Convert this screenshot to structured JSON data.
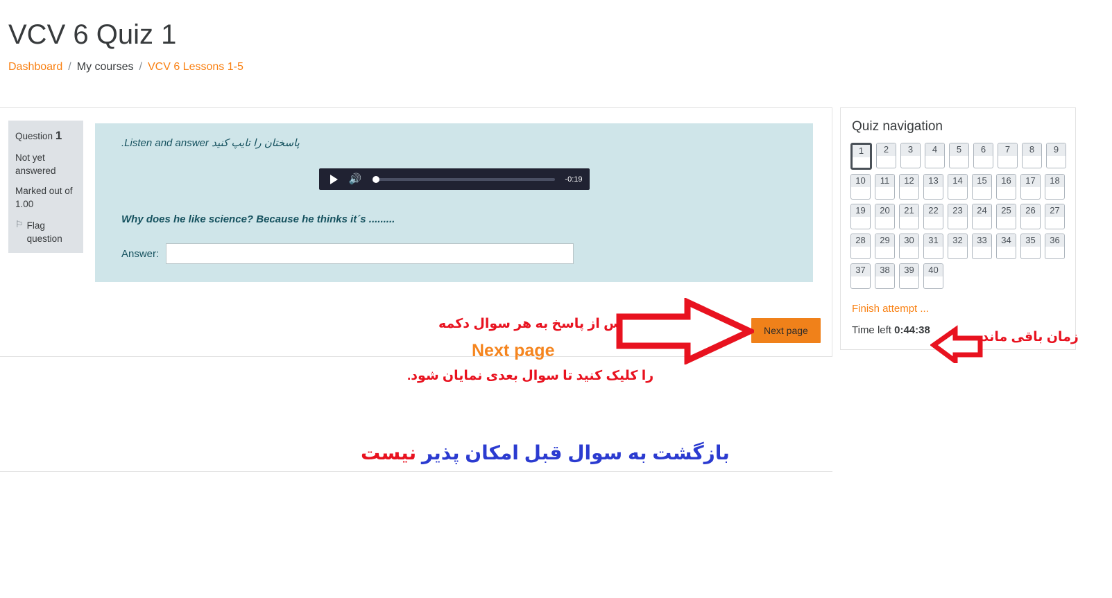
{
  "header": {
    "title": "VCV 6 Quiz 1",
    "breadcrumb": {
      "dashboard": "Dashboard",
      "sep1": "/",
      "my_courses": "My courses",
      "sep2": "/",
      "course": "VCV 6 Lessons 1-5"
    }
  },
  "question": {
    "info": {
      "label": "Question",
      "number": "1",
      "status": "Not yet answered",
      "marked_out_of": "Marked out of 1.00",
      "flag_label": "Flag question",
      "flag_icon": "flag-icon"
    },
    "instruction_rtl": "پاسختان را تایپ کنید",
    "instruction_en": "Listen and answer.",
    "prompt": "Why does he like science? Because he thinks it´s .........",
    "answer_label": "Answer:",
    "answer_value": "",
    "answer_placeholder": "",
    "audio": {
      "play_icon": "play-icon",
      "volume_icon": "volume-icon",
      "time_remaining": "-0:19",
      "progress_percent": 0
    }
  },
  "actions": {
    "next_page": "Next page"
  },
  "nav": {
    "title": "Quiz navigation",
    "questions": [
      {
        "n": "1",
        "current": true
      },
      {
        "n": "2",
        "current": false
      },
      {
        "n": "3",
        "current": false
      },
      {
        "n": "4",
        "current": false
      },
      {
        "n": "5",
        "current": false
      },
      {
        "n": "6",
        "current": false
      },
      {
        "n": "7",
        "current": false
      },
      {
        "n": "8",
        "current": false
      },
      {
        "n": "9",
        "current": false
      },
      {
        "n": "10",
        "current": false
      },
      {
        "n": "11",
        "current": false
      },
      {
        "n": "12",
        "current": false
      },
      {
        "n": "13",
        "current": false
      },
      {
        "n": "14",
        "current": false
      },
      {
        "n": "15",
        "current": false
      },
      {
        "n": "16",
        "current": false
      },
      {
        "n": "17",
        "current": false
      },
      {
        "n": "18",
        "current": false
      },
      {
        "n": "19",
        "current": false
      },
      {
        "n": "20",
        "current": false
      },
      {
        "n": "21",
        "current": false
      },
      {
        "n": "22",
        "current": false
      },
      {
        "n": "23",
        "current": false
      },
      {
        "n": "24",
        "current": false
      },
      {
        "n": "25",
        "current": false
      },
      {
        "n": "26",
        "current": false
      },
      {
        "n": "27",
        "current": false
      },
      {
        "n": "28",
        "current": false
      },
      {
        "n": "29",
        "current": false
      },
      {
        "n": "30",
        "current": false
      },
      {
        "n": "31",
        "current": false
      },
      {
        "n": "32",
        "current": false
      },
      {
        "n": "33",
        "current": false
      },
      {
        "n": "34",
        "current": false
      },
      {
        "n": "35",
        "current": false
      },
      {
        "n": "36",
        "current": false
      },
      {
        "n": "37",
        "current": false
      },
      {
        "n": "38",
        "current": false
      },
      {
        "n": "39",
        "current": false
      },
      {
        "n": "40",
        "current": false
      }
    ],
    "finish_attempt": "Finish attempt ...",
    "time_left_label": "Time left",
    "time_left_value": "0:44:38"
  },
  "annotations": {
    "line1": "پس از پاسخ به هر سوال دکمه",
    "line2": "Next page",
    "line3": "را کلیک کنید تا سوال بعدی نمایان شود.",
    "line4_blue": "بازگشت به سوال قبل امکان پذیر ",
    "line4_red": "نیست",
    "time_note": "زمان باقی مانده",
    "arrow_right_icon": "arrow-right-icon",
    "arrow_left_icon": "arrow-left-icon"
  },
  "colors": {
    "brand_orange": "#f98012",
    "button_orange": "#f0811a",
    "question_bg": "#cfe5e9",
    "annotation_red": "#e8121f",
    "annotation_blue": "#2b3bd0",
    "annotation_orange": "#f5851f"
  }
}
